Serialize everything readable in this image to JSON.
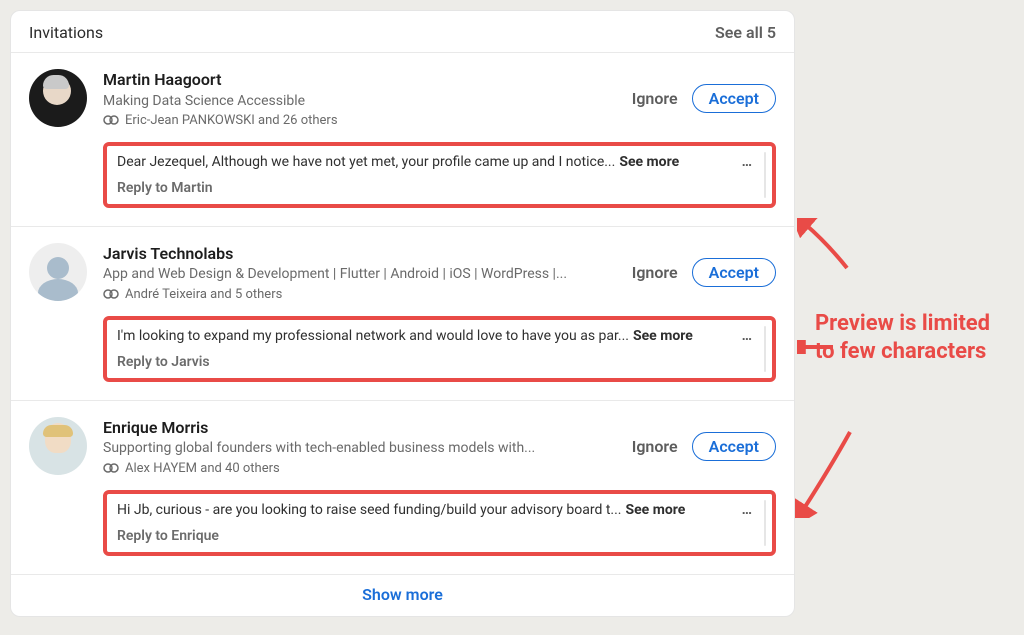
{
  "header": {
    "title": "Invitations",
    "see_all": "See all 5"
  },
  "actions": {
    "ignore": "Ignore",
    "accept": "Accept",
    "see_more": "See more",
    "overflow": "…",
    "show_more": "Show more"
  },
  "annotation": "Preview is limited to few characters",
  "invites": [
    {
      "name": "Martin Haagoort",
      "headline": "Making Data Science Accessible",
      "mutual": "Eric-Jean PANKOWSKI and 26 others",
      "snippet": "Dear Jezequel, Although we have not yet met, your profile came up and I notice...",
      "reply": "Reply to Martin"
    },
    {
      "name": "Jarvis Technolabs",
      "headline": "App and Web Design & Development | Flutter | Android | iOS | WordPress |...",
      "mutual": "André Teixeira and 5 others",
      "snippet": "I'm looking to expand my professional network and would love to have you as par...",
      "reply": "Reply to Jarvis"
    },
    {
      "name": "Enrique Morris",
      "headline": "Supporting global founders with tech-enabled business models with...",
      "mutual": "Alex HAYEM and 40 others",
      "snippet": "Hi Jb, curious - are you looking to raise seed funding/build your advisory board t...",
      "reply": "Reply to Enrique"
    }
  ]
}
